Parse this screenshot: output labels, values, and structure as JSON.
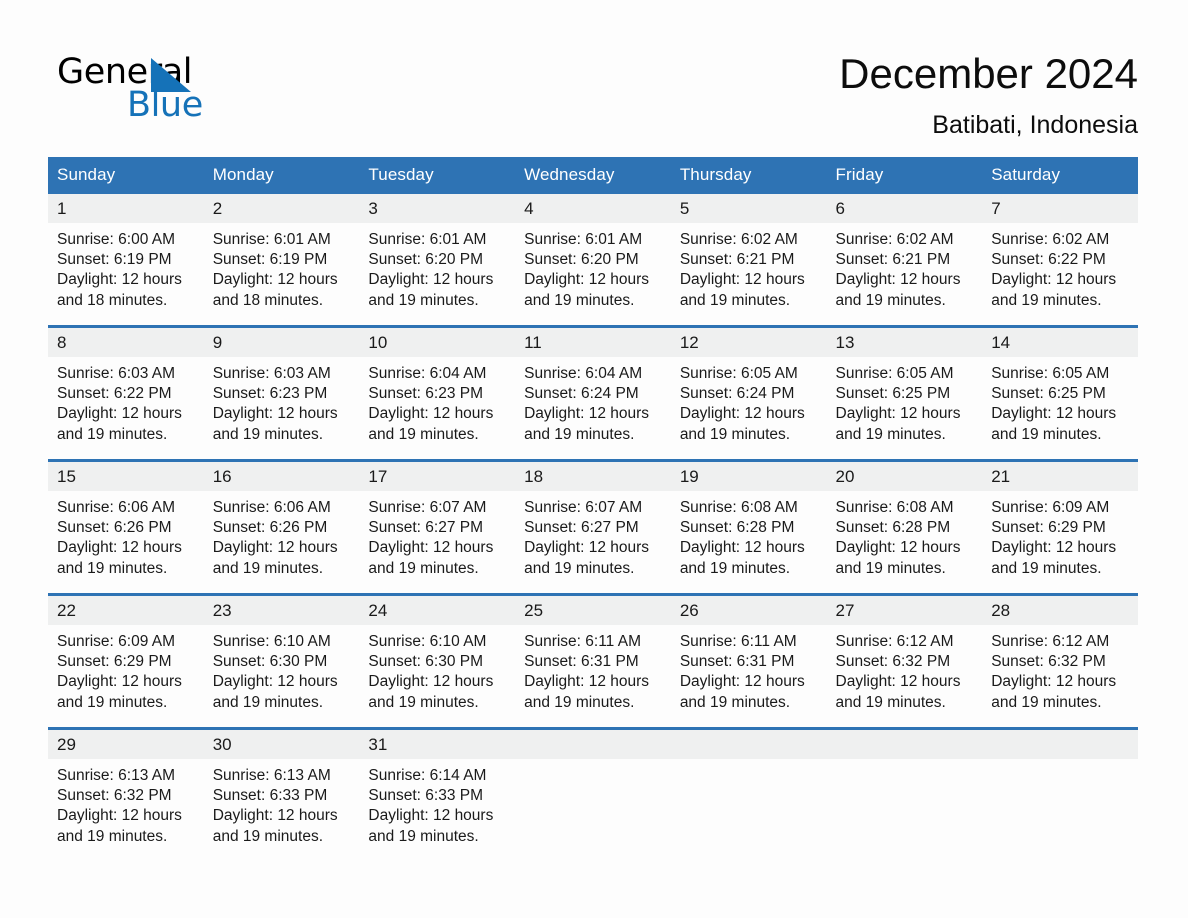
{
  "brand": {
    "name_part1": "General",
    "name_part2": "Blue",
    "triangle_icon": "blue-triangle-icon",
    "accent_color": "#1572b8"
  },
  "header": {
    "title": "December 2024",
    "location": "Batibati, Indonesia"
  },
  "theme": {
    "header_blue": "#2e73b4",
    "row_divider_blue": "#2e73b4",
    "daynum_band_gray": "#eff0f0",
    "page_background": "#fdfdfd",
    "text_color": "#1a1a1a"
  },
  "calendar": {
    "weekday_headers": [
      "Sunday",
      "Monday",
      "Tuesday",
      "Wednesday",
      "Thursday",
      "Friday",
      "Saturday"
    ],
    "weeks": [
      [
        {
          "day": "1",
          "sunrise": "Sunrise: 6:00 AM",
          "sunset": "Sunset: 6:19 PM",
          "daylight": "Daylight: 12 hours and 18 minutes."
        },
        {
          "day": "2",
          "sunrise": "Sunrise: 6:01 AM",
          "sunset": "Sunset: 6:19 PM",
          "daylight": "Daylight: 12 hours and 18 minutes."
        },
        {
          "day": "3",
          "sunrise": "Sunrise: 6:01 AM",
          "sunset": "Sunset: 6:20 PM",
          "daylight": "Daylight: 12 hours and 19 minutes."
        },
        {
          "day": "4",
          "sunrise": "Sunrise: 6:01 AM",
          "sunset": "Sunset: 6:20 PM",
          "daylight": "Daylight: 12 hours and 19 minutes."
        },
        {
          "day": "5",
          "sunrise": "Sunrise: 6:02 AM",
          "sunset": "Sunset: 6:21 PM",
          "daylight": "Daylight: 12 hours and 19 minutes."
        },
        {
          "day": "6",
          "sunrise": "Sunrise: 6:02 AM",
          "sunset": "Sunset: 6:21 PM",
          "daylight": "Daylight: 12 hours and 19 minutes."
        },
        {
          "day": "7",
          "sunrise": "Sunrise: 6:02 AM",
          "sunset": "Sunset: 6:22 PM",
          "daylight": "Daylight: 12 hours and 19 minutes."
        }
      ],
      [
        {
          "day": "8",
          "sunrise": "Sunrise: 6:03 AM",
          "sunset": "Sunset: 6:22 PM",
          "daylight": "Daylight: 12 hours and 19 minutes."
        },
        {
          "day": "9",
          "sunrise": "Sunrise: 6:03 AM",
          "sunset": "Sunset: 6:23 PM",
          "daylight": "Daylight: 12 hours and 19 minutes."
        },
        {
          "day": "10",
          "sunrise": "Sunrise: 6:04 AM",
          "sunset": "Sunset: 6:23 PM",
          "daylight": "Daylight: 12 hours and 19 minutes."
        },
        {
          "day": "11",
          "sunrise": "Sunrise: 6:04 AM",
          "sunset": "Sunset: 6:24 PM",
          "daylight": "Daylight: 12 hours and 19 minutes."
        },
        {
          "day": "12",
          "sunrise": "Sunrise: 6:05 AM",
          "sunset": "Sunset: 6:24 PM",
          "daylight": "Daylight: 12 hours and 19 minutes."
        },
        {
          "day": "13",
          "sunrise": "Sunrise: 6:05 AM",
          "sunset": "Sunset: 6:25 PM",
          "daylight": "Daylight: 12 hours and 19 minutes."
        },
        {
          "day": "14",
          "sunrise": "Sunrise: 6:05 AM",
          "sunset": "Sunset: 6:25 PM",
          "daylight": "Daylight: 12 hours and 19 minutes."
        }
      ],
      [
        {
          "day": "15",
          "sunrise": "Sunrise: 6:06 AM",
          "sunset": "Sunset: 6:26 PM",
          "daylight": "Daylight: 12 hours and 19 minutes."
        },
        {
          "day": "16",
          "sunrise": "Sunrise: 6:06 AM",
          "sunset": "Sunset: 6:26 PM",
          "daylight": "Daylight: 12 hours and 19 minutes."
        },
        {
          "day": "17",
          "sunrise": "Sunrise: 6:07 AM",
          "sunset": "Sunset: 6:27 PM",
          "daylight": "Daylight: 12 hours and 19 minutes."
        },
        {
          "day": "18",
          "sunrise": "Sunrise: 6:07 AM",
          "sunset": "Sunset: 6:27 PM",
          "daylight": "Daylight: 12 hours and 19 minutes."
        },
        {
          "day": "19",
          "sunrise": "Sunrise: 6:08 AM",
          "sunset": "Sunset: 6:28 PM",
          "daylight": "Daylight: 12 hours and 19 minutes."
        },
        {
          "day": "20",
          "sunrise": "Sunrise: 6:08 AM",
          "sunset": "Sunset: 6:28 PM",
          "daylight": "Daylight: 12 hours and 19 minutes."
        },
        {
          "day": "21",
          "sunrise": "Sunrise: 6:09 AM",
          "sunset": "Sunset: 6:29 PM",
          "daylight": "Daylight: 12 hours and 19 minutes."
        }
      ],
      [
        {
          "day": "22",
          "sunrise": "Sunrise: 6:09 AM",
          "sunset": "Sunset: 6:29 PM",
          "daylight": "Daylight: 12 hours and 19 minutes."
        },
        {
          "day": "23",
          "sunrise": "Sunrise: 6:10 AM",
          "sunset": "Sunset: 6:30 PM",
          "daylight": "Daylight: 12 hours and 19 minutes."
        },
        {
          "day": "24",
          "sunrise": "Sunrise: 6:10 AM",
          "sunset": "Sunset: 6:30 PM",
          "daylight": "Daylight: 12 hours and 19 minutes."
        },
        {
          "day": "25",
          "sunrise": "Sunrise: 6:11 AM",
          "sunset": "Sunset: 6:31 PM",
          "daylight": "Daylight: 12 hours and 19 minutes."
        },
        {
          "day": "26",
          "sunrise": "Sunrise: 6:11 AM",
          "sunset": "Sunset: 6:31 PM",
          "daylight": "Daylight: 12 hours and 19 minutes."
        },
        {
          "day": "27",
          "sunrise": "Sunrise: 6:12 AM",
          "sunset": "Sunset: 6:32 PM",
          "daylight": "Daylight: 12 hours and 19 minutes."
        },
        {
          "day": "28",
          "sunrise": "Sunrise: 6:12 AM",
          "sunset": "Sunset: 6:32 PM",
          "daylight": "Daylight: 12 hours and 19 minutes."
        }
      ],
      [
        {
          "day": "29",
          "sunrise": "Sunrise: 6:13 AM",
          "sunset": "Sunset: 6:32 PM",
          "daylight": "Daylight: 12 hours and 19 minutes."
        },
        {
          "day": "30",
          "sunrise": "Sunrise: 6:13 AM",
          "sunset": "Sunset: 6:33 PM",
          "daylight": "Daylight: 12 hours and 19 minutes."
        },
        {
          "day": "31",
          "sunrise": "Sunrise: 6:14 AM",
          "sunset": "Sunset: 6:33 PM",
          "daylight": "Daylight: 12 hours and 19 minutes."
        },
        {
          "day": "",
          "sunrise": "",
          "sunset": "",
          "daylight": ""
        },
        {
          "day": "",
          "sunrise": "",
          "sunset": "",
          "daylight": ""
        },
        {
          "day": "",
          "sunrise": "",
          "sunset": "",
          "daylight": ""
        },
        {
          "day": "",
          "sunrise": "",
          "sunset": "",
          "daylight": ""
        }
      ]
    ]
  }
}
